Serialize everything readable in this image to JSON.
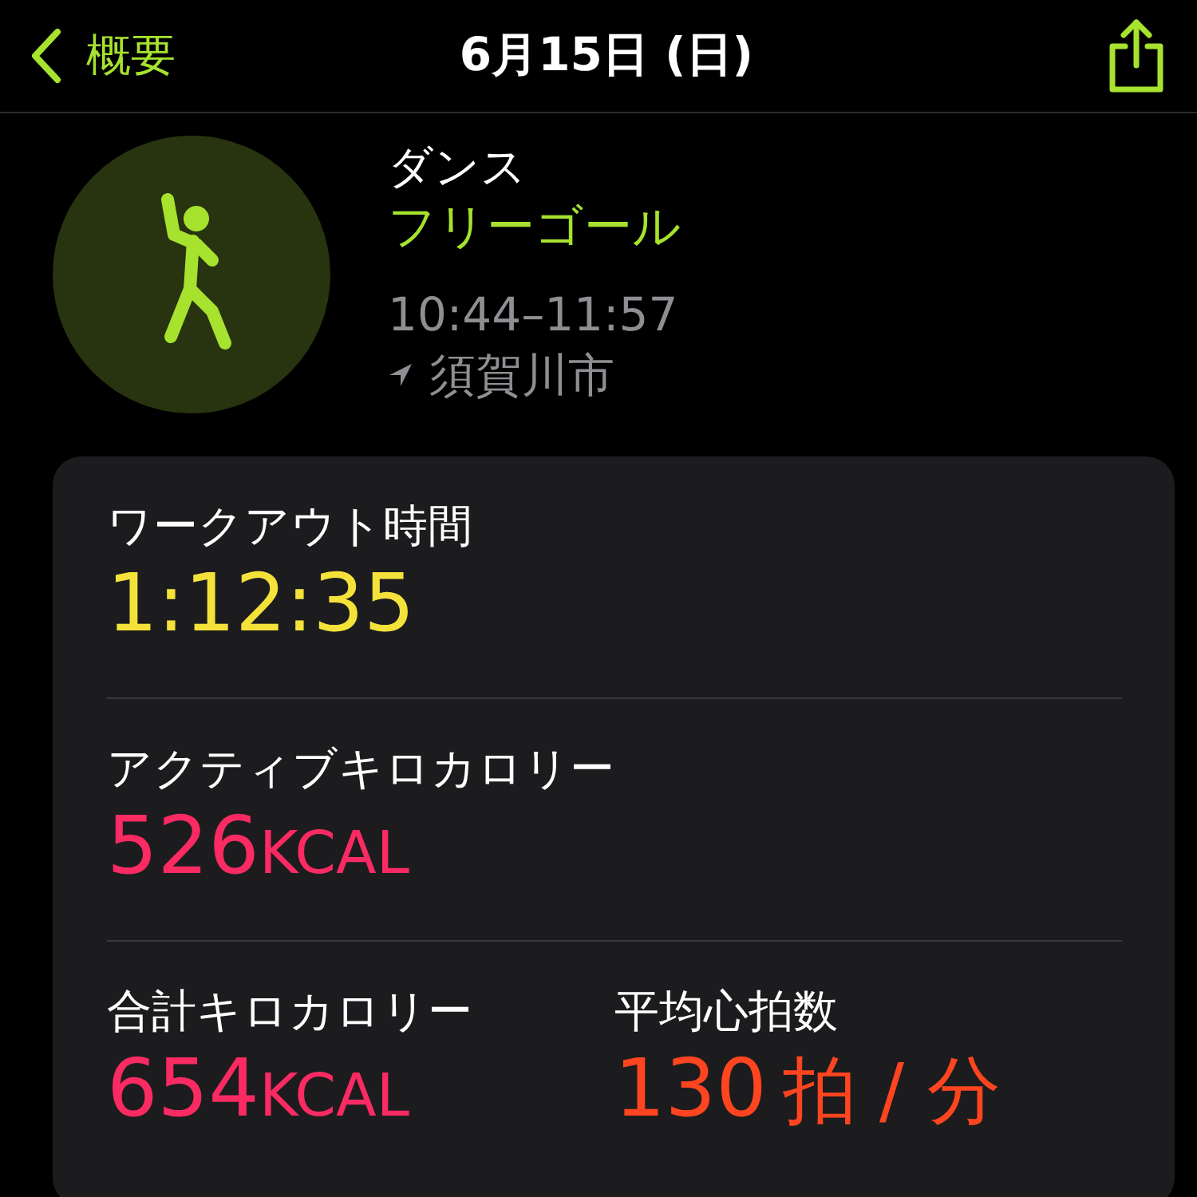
{
  "header": {
    "back_label": "概要",
    "title": "6月15日 (日)"
  },
  "workout": {
    "type": "ダンス",
    "goal": "フリーゴール",
    "time_range": "10:44–11:57",
    "location": "須賀川市"
  },
  "stat_rows": [
    {
      "stats": [
        {
          "label": "ワークアウト時間",
          "value": "1:12:35",
          "color": "#f4e23a"
        }
      ]
    },
    {
      "stats": [
        {
          "label": "アクティブキロカロリー",
          "value": "526",
          "unit": "KCAL",
          "color": "#fa2a63"
        }
      ]
    },
    {
      "stats": [
        {
          "label": "合計キロカロリー",
          "value": "654",
          "unit": "KCAL",
          "color": "#fa2a63"
        },
        {
          "label": "平均心拍数",
          "value": "130",
          "unit": "拍 / 分",
          "color": "#ff4420"
        }
      ]
    }
  ]
}
